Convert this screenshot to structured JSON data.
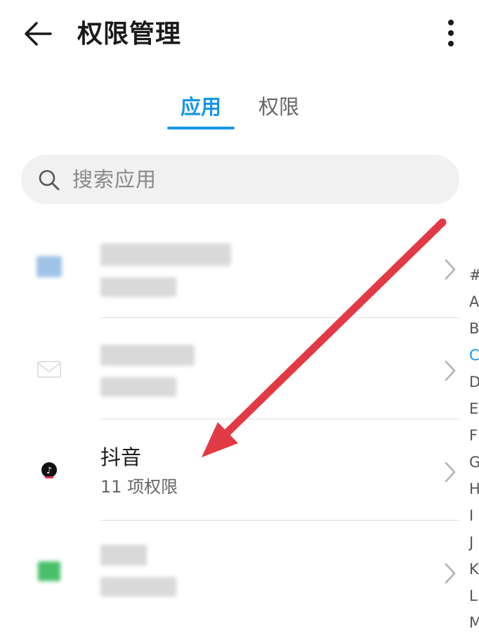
{
  "header": {
    "title": "权限管理",
    "back_icon": "arrow-left-icon",
    "more_icon": "more-vertical-icon"
  },
  "tabs": [
    {
      "label": "应用",
      "active": true
    },
    {
      "label": "权限",
      "active": false
    }
  ],
  "search": {
    "placeholder": "搜索应用",
    "icon": "search-icon"
  },
  "apps": [
    {
      "name": "",
      "subtitle": "",
      "blurred": true
    },
    {
      "name": "",
      "subtitle": "",
      "blurred": true
    },
    {
      "name": "抖音",
      "subtitle": "11 项权限",
      "blurred": false
    },
    {
      "name": "",
      "subtitle": "",
      "blurred": true
    }
  ],
  "index_letters": [
    "#",
    "A",
    "B",
    "C",
    "D",
    "E",
    "F",
    "G",
    "H",
    "I",
    "J",
    "K",
    "L",
    "M"
  ],
  "active_index_letter": "C",
  "colors": {
    "accent": "#1796e8",
    "annotation_arrow": "#e23a44",
    "chevron": "#b3b3b3",
    "text": "#1a1a1a"
  }
}
